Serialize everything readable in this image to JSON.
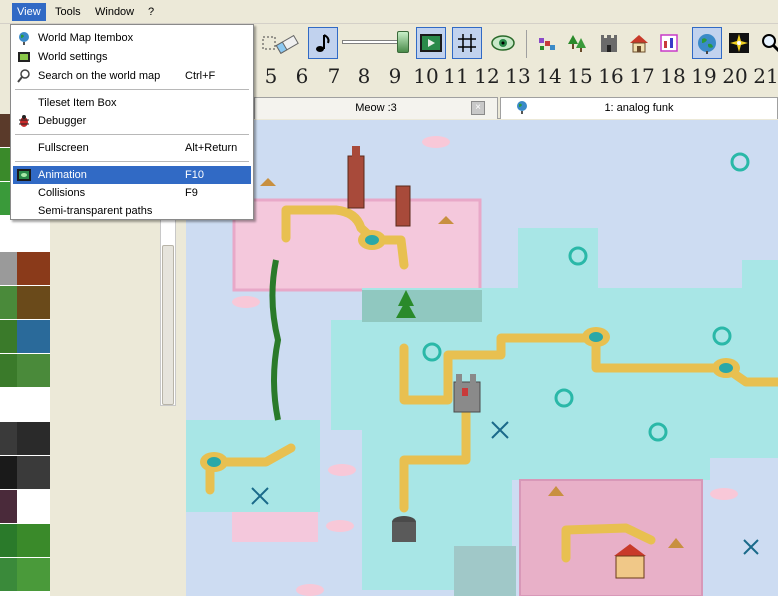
{
  "menubar": {
    "items": [
      {
        "label": "View",
        "active": true
      },
      {
        "label": "Tools"
      },
      {
        "label": "Window"
      },
      {
        "label": "?"
      }
    ]
  },
  "view_menu": {
    "items": [
      {
        "label": "World Map Itembox",
        "shortcut": "",
        "icon": "globe-icon"
      },
      {
        "label": "World settings",
        "shortcut": "",
        "icon": "film-icon"
      },
      {
        "label": "Search on the world map",
        "shortcut": "Ctrl+F",
        "icon": "magnifier-icon"
      },
      {
        "label": "Tileset Item Box",
        "shortcut": "",
        "icon": ""
      },
      {
        "label": "Debugger",
        "shortcut": "",
        "icon": "bug-icon"
      },
      {
        "label": "Fullscreen",
        "shortcut": "Alt+Return",
        "icon": ""
      },
      {
        "label": "Animation",
        "shortcut": "F10",
        "icon": "animation-icon",
        "highlighted": true
      },
      {
        "label": "Collisions",
        "shortcut": "F9",
        "icon": ""
      },
      {
        "label": "Semi-transparent paths",
        "shortcut": "",
        "icon": ""
      }
    ]
  },
  "layers": [
    "5",
    "6",
    "7",
    "8",
    "9",
    "10",
    "11",
    "12",
    "13",
    "14",
    "15",
    "16",
    "17",
    "18",
    "19",
    "20",
    "21"
  ],
  "tabs": [
    {
      "label": "Meow :3",
      "close": "×"
    },
    {
      "label": "1: analog funk",
      "active": true
    }
  ],
  "colors": {
    "menu_highlight": "#316ac5",
    "map_background": "#cddcf2",
    "ice_ground": "#a8e6e6",
    "pink_ground": "#f4c8dc",
    "path": "#e8c050"
  }
}
